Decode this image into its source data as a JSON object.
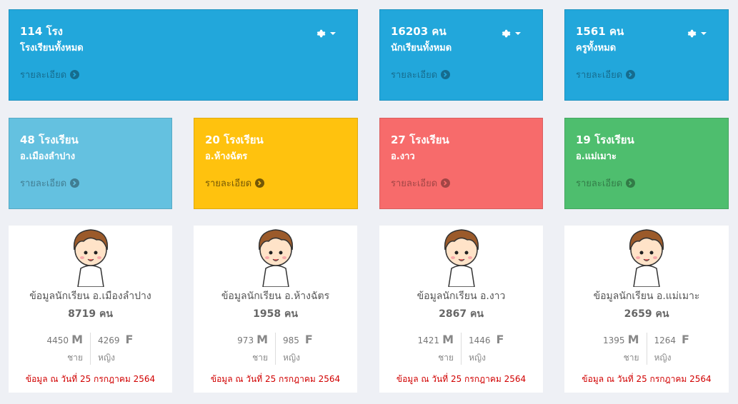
{
  "top_tiles": [
    {
      "number": "114 โรง",
      "label": "โรงเรียนทั้งหมด",
      "more": "รายละเอียด"
    },
    {
      "number": "16203 คน",
      "label": "นักเรียนทั้งหมด",
      "more": "รายละเอียด"
    },
    {
      "number": "1561 คน",
      "label": "ครูทั้งหมด",
      "more": "รายละเอียด"
    }
  ],
  "district_tiles": [
    {
      "number": "48 โรงเรียน",
      "label": "อ.เมืองลำปาง",
      "more": "รายละเอียด"
    },
    {
      "number": "20 โรงเรียน",
      "label": "อ.ห้างฉัตร",
      "more": "รายละเอียด"
    },
    {
      "number": "27 โรงเรียน",
      "label": "อ.งาว",
      "more": "รายละเอียด"
    },
    {
      "number": "19 โรงเรียน",
      "label": "อ.แม่เมาะ",
      "more": "รายละเอียด"
    }
  ],
  "cards": [
    {
      "title": "ข้อมูลนักเรียน อ.เมืองลำปาง",
      "total": "8719 คน",
      "male": "4450",
      "female": "4269",
      "m": "M",
      "f": "F",
      "male_label": "ชาย",
      "female_label": "หญิง",
      "date": "ข้อมูล ณ วันที่ 25 กรกฎาคม 2564"
    },
    {
      "title": "ข้อมูลนักเรียน อ.ห้างฉัตร",
      "total": "1958 คน",
      "male": "973",
      "female": "985",
      "m": "M",
      "f": "F",
      "male_label": "ชาย",
      "female_label": "หญิง",
      "date": "ข้อมูล ณ วันที่ 25 กรกฎาคม 2564"
    },
    {
      "title": "ข้อมูลนักเรียน อ.งาว",
      "total": "2867 คน",
      "male": "1421",
      "female": "1446",
      "m": "M",
      "f": "F",
      "male_label": "ชาย",
      "female_label": "หญิง",
      "date": "ข้อมูล ณ วันที่ 25 กรกฎาคม 2564"
    },
    {
      "title": "ข้อมูลนักเรียน อ.แม่เมาะ",
      "total": "2659 คน",
      "male": "1395",
      "female": "1264",
      "m": "M",
      "f": "F",
      "male_label": "ชาย",
      "female_label": "หญิง",
      "date": "ข้อมูล ณ วันที่ 25 กรกฎาคม 2564"
    }
  ],
  "colors": {
    "blue": "#22a7db",
    "light_blue": "#64c1e0",
    "yellow": "#ffc20e",
    "red": "#f76b6b",
    "green": "#4ebe6e"
  },
  "icons": {
    "settings": "gear-icon",
    "details": "arrow-circle-right-icon",
    "avatar": "student-boy-icon"
  }
}
